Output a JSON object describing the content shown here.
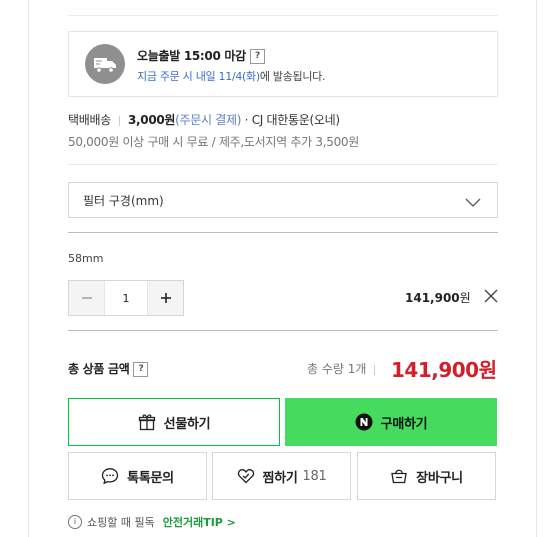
{
  "shipping": {
    "deadline_label": "오늘출발 15:00 마감",
    "help_mark": "?",
    "notice_prefix": "지금 주문 시 내일",
    "notice_date": "11/4(화)",
    "notice_suffix": "에 발송됩니다.",
    "icon": "truck-icon"
  },
  "delivery": {
    "method": "택배배송",
    "fee": "3,000원",
    "payment_note": "(주문시 결제)",
    "carrier": "CJ 대한통운(오네)",
    "condition": "50,000원 이상 구매 시 무료 / 제주,도서지역 추가 3,500원"
  },
  "option_select": {
    "placeholder": "필터 구경(mm)"
  },
  "selected_option": {
    "name": "58mm",
    "quantity": "1",
    "price": "141,900",
    "price_unit": "원"
  },
  "total": {
    "label": "총 상품 금액",
    "help_mark": "?",
    "qty_label": "총 수량 1개",
    "price": "141,900원"
  },
  "actions": {
    "gift_label": "선물하기",
    "buy_label": "구매하기",
    "talk_label": "톡톡문의",
    "wish_label": "찜하기",
    "wish_count": "181",
    "cart_label": "장바구니"
  },
  "tip": {
    "text": "쇼핑할 때 필독",
    "link": "안전거래TIP >"
  },
  "colors": {
    "accent_green": "#44db5e",
    "price_red": "#d1202b",
    "link_blue": "#3b6ec9"
  }
}
